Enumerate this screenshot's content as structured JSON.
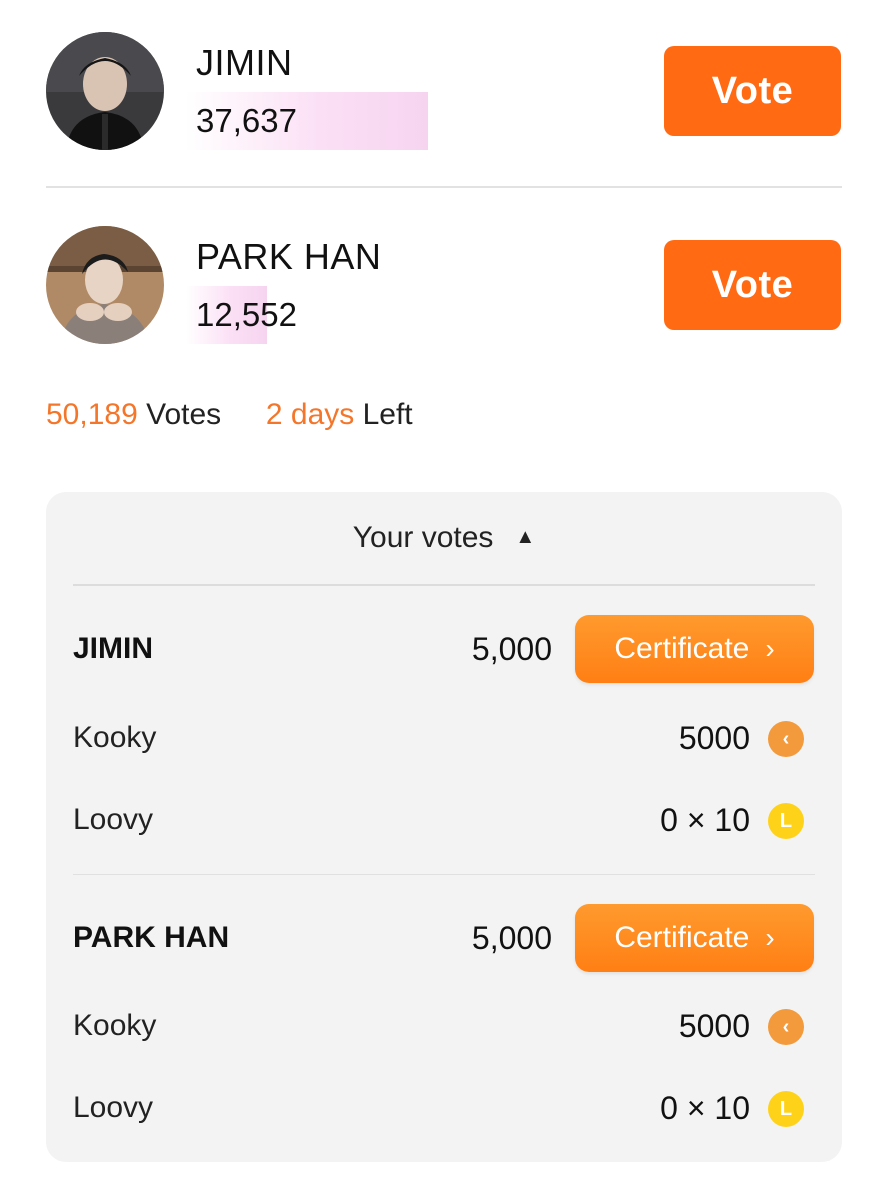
{
  "candidates": [
    {
      "name": "JIMIN",
      "votes": "37,637",
      "vote_share": 0.75,
      "vote_label": "Vote"
    },
    {
      "name": "PARK HAN",
      "votes": "12,552",
      "vote_share": 0.25,
      "vote_label": "Vote"
    }
  ],
  "stats": {
    "total_votes": "50,189",
    "votes_word": "Votes",
    "days": "2 days",
    "left_word": "Left"
  },
  "your_votes": {
    "header": "Your votes",
    "entries": [
      {
        "name": "JIMIN",
        "count": "5,000",
        "certificate_label": "Certificate",
        "kooky_label": "Kooky",
        "kooky_value": "5000",
        "loovy_label": "Loovy",
        "loovy_value": "0 × 10"
      },
      {
        "name": "PARK HAN",
        "count": "5,000",
        "certificate_label": "Certificate",
        "kooky_label": "Kooky",
        "kooky_value": "5000",
        "loovy_label": "Loovy",
        "loovy_value": "0 × 10"
      }
    ]
  },
  "icons": {
    "kooky_coin": "kooky-coin-icon",
    "loovy_coin": "loovy-coin-icon",
    "kooky_glyph": "‹",
    "loovy_glyph": "L"
  },
  "colors": {
    "accent": "#ff6a13",
    "stat_highlight": "#f4762a",
    "certificate": "#ff8a1f",
    "vote_bar": "#f6d4f0",
    "kooky_coin": "#f29a3c",
    "loovy_coin": "#ffd21a"
  }
}
